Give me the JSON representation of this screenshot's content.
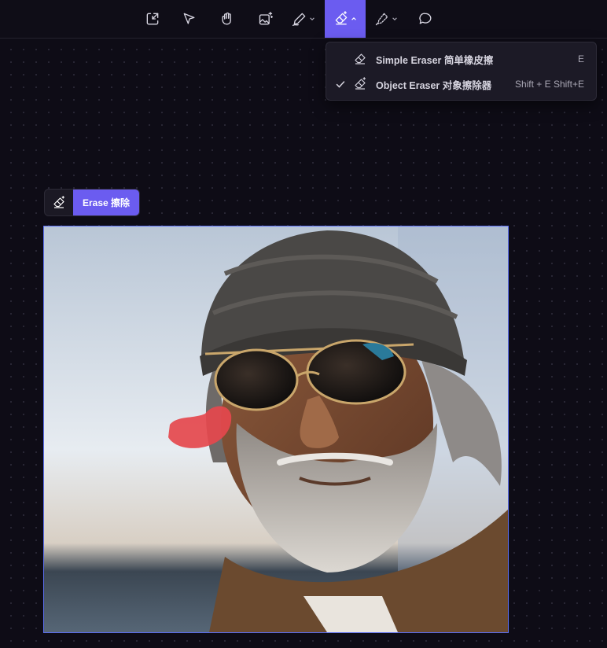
{
  "toolbar": {
    "tools": [
      {
        "name": "import-icon"
      },
      {
        "name": "select-icon"
      },
      {
        "name": "hand-icon"
      },
      {
        "name": "ai-image-icon"
      },
      {
        "name": "pen-icon"
      },
      {
        "name": "eraser-icon",
        "active": true
      },
      {
        "name": "brush-icon"
      },
      {
        "name": "comment-icon"
      }
    ],
    "accent": "#6b5cf0"
  },
  "dropdown": {
    "items": [
      {
        "label": "Simple Eraser 简单橡皮擦",
        "shortcut": "E",
        "checked": false
      },
      {
        "label": "Object Eraser 对象擦除器",
        "shortcut": "Shift + E Shift+E",
        "checked": true
      }
    ]
  },
  "erase_bar": {
    "button_label": "Erase 擦除"
  },
  "canvas": {
    "image_subject": "portrait-photo",
    "mask_color": "#e5484d",
    "selection_border": "#5b6ef0"
  }
}
